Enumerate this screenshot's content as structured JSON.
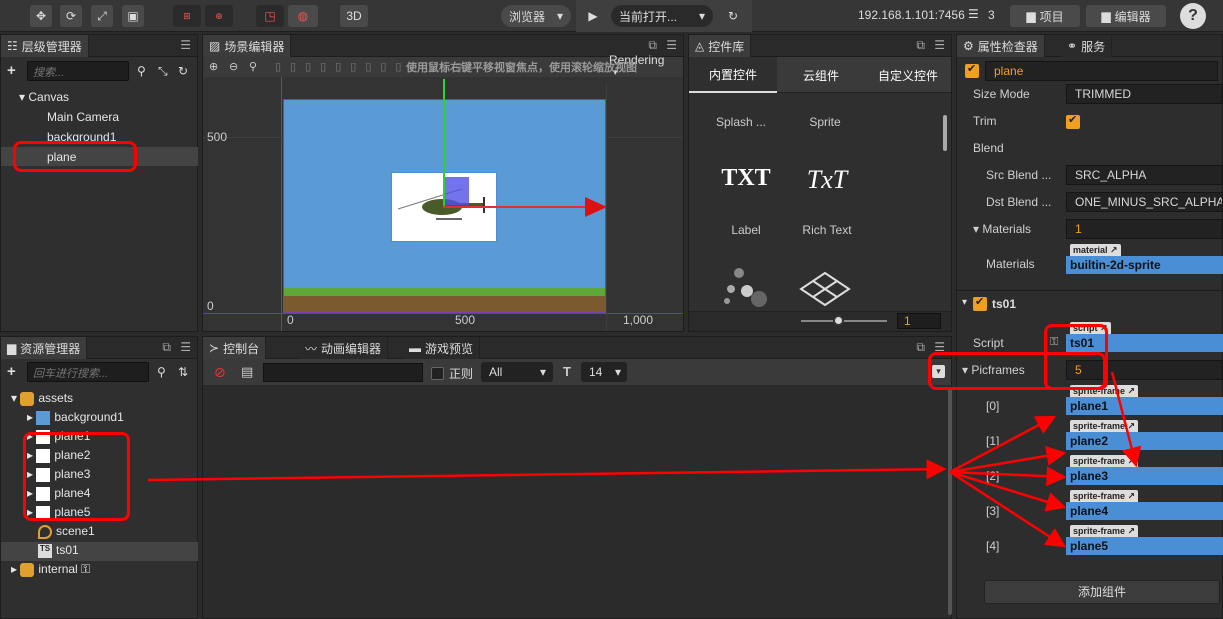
{
  "toolbar": {
    "tool_3d": "3D",
    "browser_label": "浏览器",
    "play_target": "当前打开...",
    "ip": "192.168.1.101:7456",
    "wifi_count": "3",
    "project_btn": "项目",
    "editor_btn": "编辑器",
    "help": "?"
  },
  "hierarchy": {
    "title": "层级管理器",
    "search_placeholder": "搜索...",
    "items": [
      "Canvas",
      "Main Camera",
      "background1",
      "plane"
    ]
  },
  "scene": {
    "title": "场景编辑器",
    "rendering": "Rendering",
    "hint": "使用鼠标右键平移视窗焦点，使用滚轮缩放视图",
    "axis_y_500": "500",
    "axis_y_0": "0",
    "axis_x_0": "0",
    "axis_x_500": "500",
    "axis_x_1000": "1,000"
  },
  "widgets": {
    "title": "控件库",
    "tabs": [
      "内置控件",
      "云组件",
      "自定义控件"
    ],
    "items": [
      {
        "glyph": "",
        "label": "Splash ..."
      },
      {
        "glyph": "",
        "label": "Sprite"
      },
      {
        "glyph": "TXT",
        "label": "Label"
      },
      {
        "glyph": "TxT",
        "label": "Rich Text"
      }
    ],
    "zoom_value": "1"
  },
  "assets": {
    "title": "资源管理器",
    "search_placeholder": "回车进行搜索...",
    "items": [
      "assets",
      "background1",
      "plane1",
      "plane2",
      "plane3",
      "plane4",
      "plane5",
      "scene1",
      "ts01",
      "internal"
    ]
  },
  "console": {
    "tabs": [
      "控制台",
      "动画编辑器",
      "游戏预览"
    ],
    "regex_label": "正则",
    "level": "All",
    "font_size": "14"
  },
  "inspector": {
    "tabs": [
      "属性检查器",
      "服务"
    ],
    "node_name": "plane",
    "size_mode_label": "Size Mode",
    "size_mode": "TRIMMED",
    "trim_label": "Trim",
    "blend_label": "Blend",
    "src_blend_label": "Src Blend ...",
    "src_blend": "SRC_ALPHA",
    "dst_blend_label": "Dst Blend ...",
    "dst_blend": "ONE_MINUS_SRC_ALPHA",
    "materials_label": "Materials",
    "materials_count": "1",
    "material_tag": "material",
    "material_value": "builtin-2d-sprite",
    "component_name": "ts01",
    "script_label": "Script",
    "script_tag": "script",
    "script_value": "ts01",
    "picframes_label": "Picframes",
    "picframes_count": "5",
    "frame_tag": "sprite-frame",
    "frames": [
      {
        "index": "[0]",
        "value": "plane1"
      },
      {
        "index": "[1]",
        "value": "plane2"
      },
      {
        "index": "[2]",
        "value": "plane3"
      },
      {
        "index": "[3]",
        "value": "plane4"
      },
      {
        "index": "[4]",
        "value": "plane5"
      }
    ],
    "add_component": "添加组件"
  },
  "colors": {
    "annotation": "#ff0000",
    "accent_orange": "#f0a020",
    "asset_blue": "#4a8fd6",
    "scene_sky": "#5b9bd5"
  }
}
